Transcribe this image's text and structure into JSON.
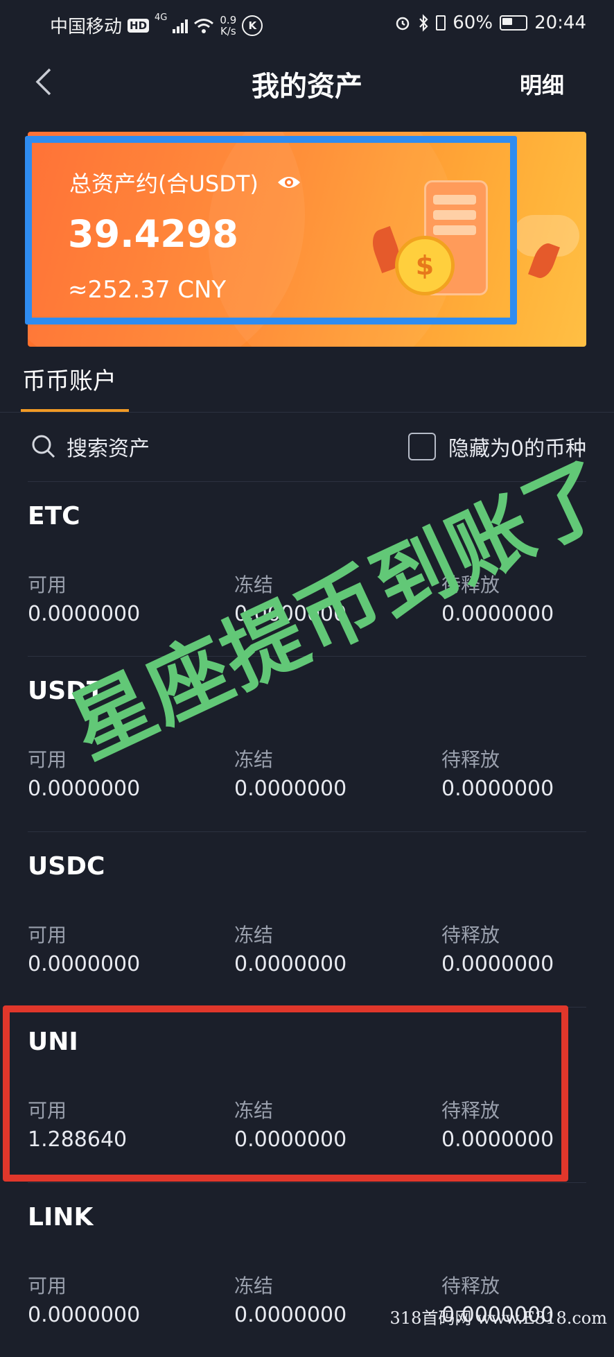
{
  "status_bar": {
    "carrier": "中国移动",
    "hd": "HD",
    "net_type": "4G",
    "speed_value": "0.9",
    "speed_unit": "K/s",
    "k_badge": "K",
    "battery": "60%",
    "time": "20:44"
  },
  "header": {
    "title": "我的资产",
    "detail_label": "明细"
  },
  "summary": {
    "label": "总资产约(合USDT)",
    "total": "39.4298",
    "cny": "≈252.37 CNY",
    "coin_symbol": "$"
  },
  "tabs": [
    {
      "label": "币币账户"
    }
  ],
  "search": {
    "label": "搜索资产"
  },
  "filter": {
    "hide_zero_label": "隐藏为0的币种",
    "checked": false
  },
  "columns": {
    "available": "可用",
    "frozen": "冻结",
    "pending": "待释放"
  },
  "coins": [
    {
      "name": "ETC",
      "available": "0.0000000",
      "frozen": "0.0000000",
      "pending": "0.0000000"
    },
    {
      "name": "USDT",
      "available": "0.0000000",
      "frozen": "0.0000000",
      "pending": "0.0000000"
    },
    {
      "name": "USDC",
      "available": "0.0000000",
      "frozen": "0.0000000",
      "pending": "0.0000000"
    },
    {
      "name": "UNI",
      "available": "1.288640",
      "frozen": "0.0000000",
      "pending": "0.0000000"
    },
    {
      "name": "LINK",
      "available": "0.0000000",
      "frozen": "0.0000000",
      "pending": "0.0000000"
    }
  ],
  "annotation": {
    "text": "星座提币到账了"
  },
  "site_watermark": "318首码网 www.E318.com",
  "colors": {
    "background": "#1b1f2a",
    "accent_tab": "#f19a26",
    "highlight_blue": "#2f8cf0",
    "highlight_red": "#e0372b",
    "annotation_green": "#62c877"
  }
}
